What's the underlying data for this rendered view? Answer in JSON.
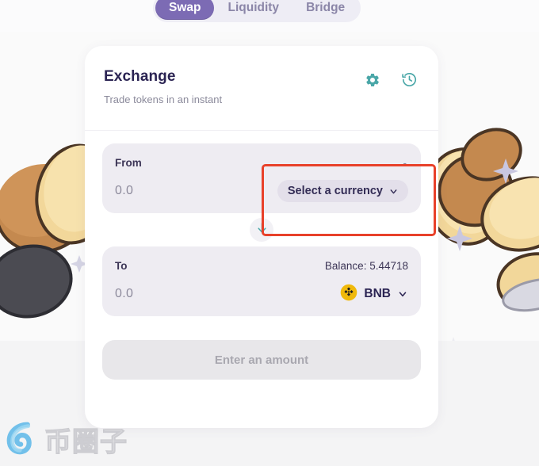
{
  "tabs": [
    {
      "label": "Swap",
      "active": true
    },
    {
      "label": "Liquidity",
      "active": false
    },
    {
      "label": "Bridge",
      "active": false
    }
  ],
  "card": {
    "title": "Exchange",
    "subtitle": "Trade tokens in an instant",
    "settings_icon": "gear-icon",
    "history_icon": "history-icon"
  },
  "from_panel": {
    "label": "From",
    "balance": "-",
    "amount": "0.0",
    "currency_label": "Select a currency",
    "chevron": "chevron-down-icon"
  },
  "swap_button": {
    "icon": "arrow-down-icon"
  },
  "to_panel": {
    "label": "To",
    "balance": "Balance: 5.44718",
    "amount": "0.0",
    "token_symbol": "BNB",
    "token_icon": "bnb-icon",
    "chevron": "chevron-down-icon"
  },
  "cta": {
    "label": "Enter an amount",
    "disabled": true
  },
  "watermark": {
    "text": "币圈子",
    "logo": "circle-swirl-logo"
  },
  "colors": {
    "page_bg": "#fafafa",
    "card_bg": "#ffffff",
    "accent_purple": "#7c6bb4",
    "title_navy": "#2b2453",
    "panel_bg": "#eeecf2",
    "pill_bg": "#e3dfea",
    "teal_icon": "#4aa7a8",
    "highlight_red": "#e8412a",
    "bnb_yellow": "#f0b90b",
    "muted_text": "#8b8a9b"
  }
}
